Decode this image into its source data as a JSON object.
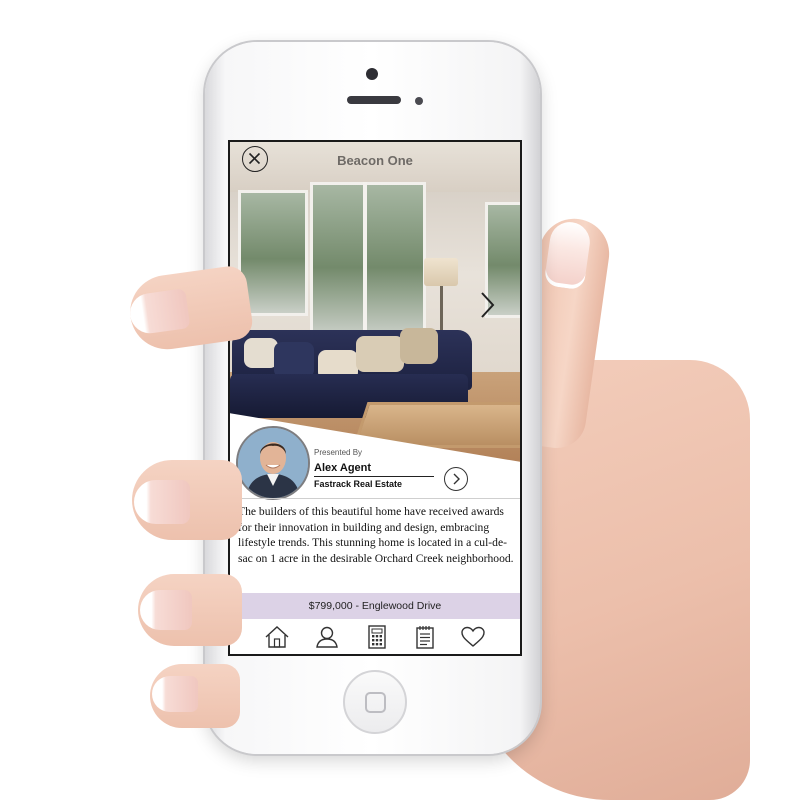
{
  "screen": {
    "title": "Beacon One",
    "agent": {
      "presented_by": "Presented By",
      "name": "Alex Agent",
      "company": "Fastrack Real Estate"
    },
    "description": "The builders of this beautiful home have received awards for their innovation in building and design, embracing lifestyle trends. This stunning home is located in a cul-de-sac on 1 acre in the desirable Orchard Creek neighborhood.",
    "price_bar": "$799,000 - Englewood Drive",
    "tabs": [
      {
        "icon": "home-icon"
      },
      {
        "icon": "person-icon"
      },
      {
        "icon": "calculator-icon"
      },
      {
        "icon": "notepad-icon"
      },
      {
        "icon": "heart-icon"
      }
    ],
    "colors": {
      "price_bar_bg": "#dcd2e6",
      "sofa": "#222848",
      "frame": "#1a1a1a"
    }
  }
}
